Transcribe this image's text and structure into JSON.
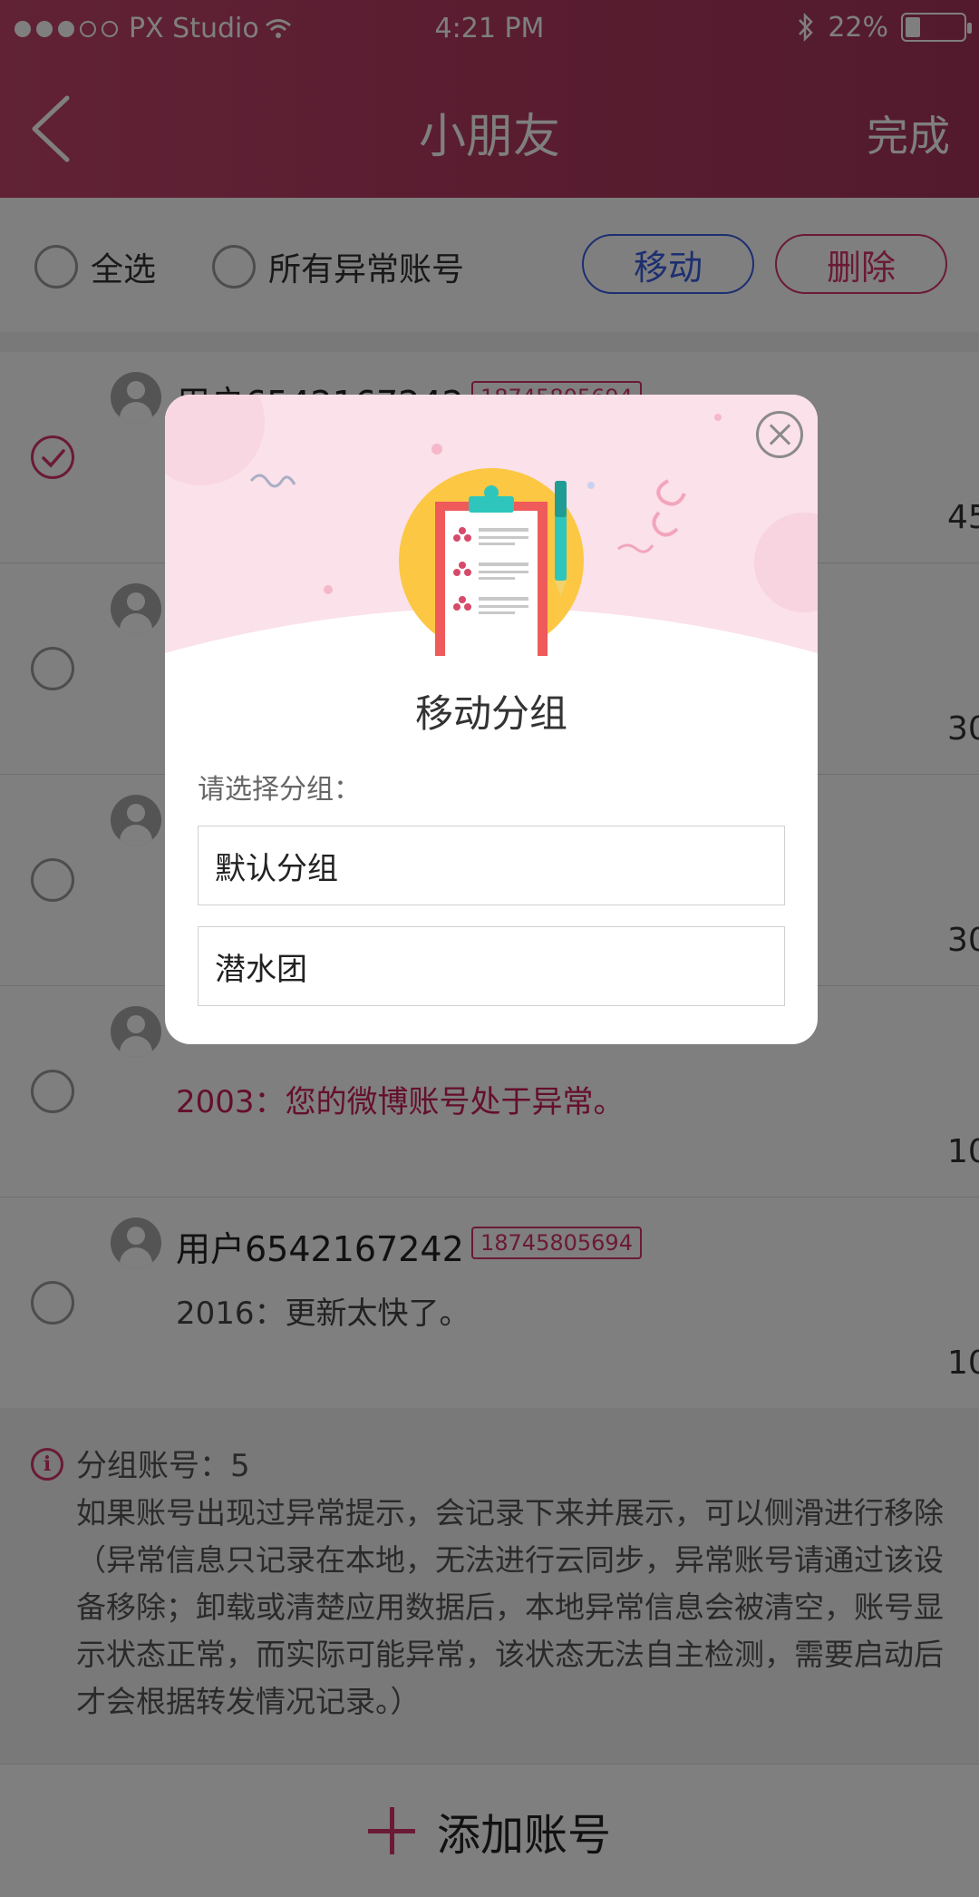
{
  "status_bar": {
    "carrier": "PX Studio",
    "time": "4:21 PM",
    "battery": "22%",
    "battery_level": 0.22
  },
  "nav": {
    "title": "小朋友",
    "done_label": "完成"
  },
  "toolbar": {
    "select_all": "全选",
    "all_abnormal": "所有异常账号",
    "move_label": "移动",
    "delete_label": "删除"
  },
  "accounts": [
    {
      "name": "用户6542167242",
      "phone": "18745805694",
      "message": "",
      "count": "45",
      "selected": true
    },
    {
      "name": "",
      "phone": "",
      "message": "",
      "count": "30",
      "selected": false
    },
    {
      "name": "",
      "phone": "",
      "message": "",
      "count": "30",
      "selected": false
    },
    {
      "name": "",
      "phone": "",
      "message": "2003：您的微博账号处于异常。",
      "count": "10",
      "selected": false
    },
    {
      "name": "用户6542167242",
      "phone": "18745805694",
      "message": "2016：更新太快了。",
      "count": "10",
      "selected": false
    }
  ],
  "info": {
    "count_text": "分组账号：5",
    "description": "如果账号出现过异常提示，会记录下来并展示，可以侧滑进行移除（异常信息只记录在本地，无法进行云同步，异常账号请通过该设备移除；卸载或清楚应用数据后，本地异常信息会被清空，账号显示状态正常，而实际可能异常，该状态无法自主检测，需要启动后才会根据转发情况记录。）"
  },
  "add_account_label": "添加账号",
  "modal": {
    "title": "移动分组",
    "prompt": "请选择分组：",
    "options": [
      "默认分组",
      "潜水团"
    ]
  },
  "colors": {
    "brand": "#c2446b",
    "accent_red": "#d6356a",
    "accent_blue": "#3b5ee0",
    "banner_pink": "#fbe1e9"
  },
  "icons": [
    "back-icon",
    "wifi-icon",
    "bluetooth-icon",
    "battery-icon",
    "checkmark-icon",
    "avatar-icon",
    "info-icon",
    "plus-icon",
    "close-icon",
    "clipboard-illustration"
  ]
}
